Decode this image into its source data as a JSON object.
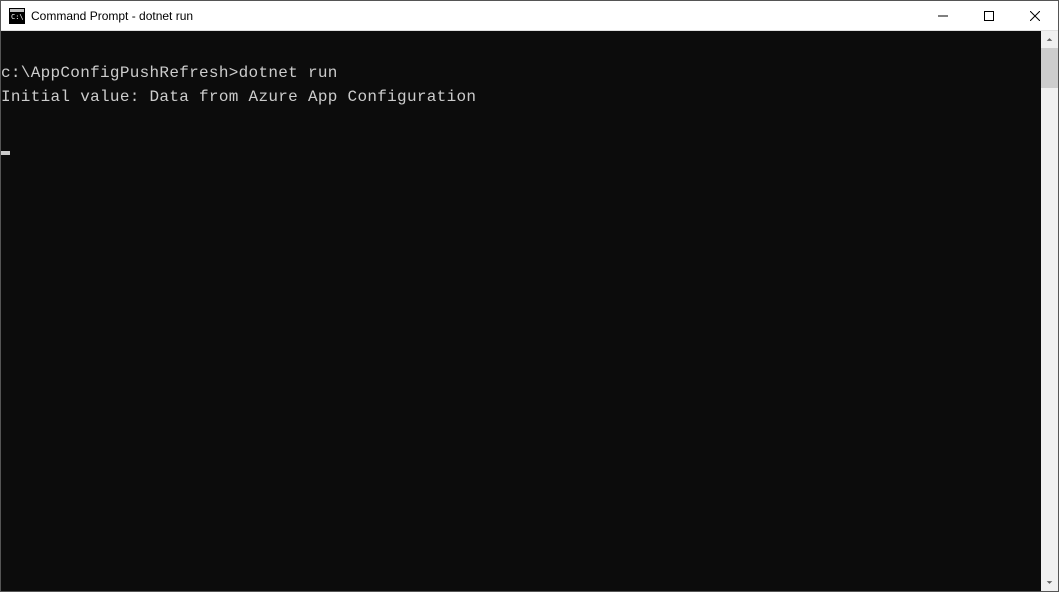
{
  "window": {
    "title": "Command Prompt - dotnet  run"
  },
  "terminal": {
    "line1_prompt": "c:\\AppConfigPushRefresh>",
    "line1_cmd": "dotnet run",
    "line2": "Initial value: Data from Azure App Configuration"
  }
}
